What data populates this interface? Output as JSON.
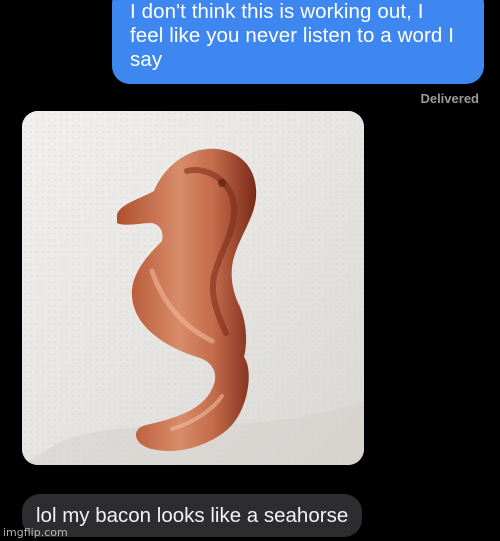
{
  "conversation": {
    "sent_message": {
      "lines": [
        "I don't think this is working out, I",
        "feel like you never listen to a word I",
        "say"
      ],
      "status": "Delivered"
    },
    "received_image": {
      "subject": "bacon-seahorse"
    },
    "received_message": {
      "text": "lol my bacon looks like a seahorse"
    }
  },
  "watermark": "imgflip.com",
  "colors": {
    "sent_bubble": "#3f87f0",
    "received_bubble": "#2d2d30",
    "background": "#000000",
    "status_text": "#9a9a9a"
  }
}
